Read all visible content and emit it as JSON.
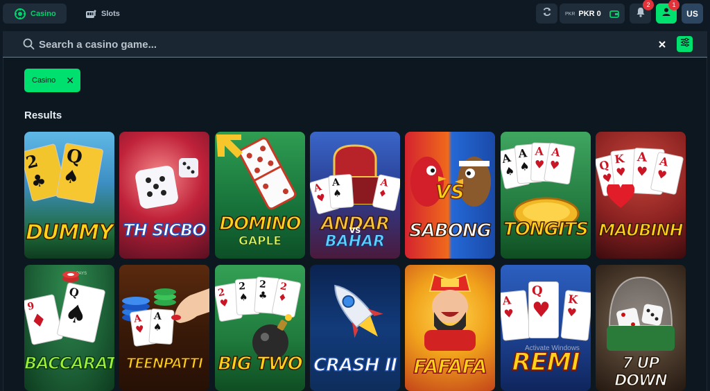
{
  "header": {
    "tabs": [
      {
        "label": "Casino",
        "icon": "casino-chip-icon",
        "active": true
      },
      {
        "label": "Slots",
        "icon": "slot-machine-icon",
        "active": false
      }
    ],
    "wallet": {
      "currency": "PKR",
      "balance": "PKR 0",
      "icon": "wallet-icon"
    },
    "notifications_count": "2",
    "profile_count": "1",
    "language": "US",
    "accent_color": "#00e06f"
  },
  "search": {
    "placeholder": "Search a casino game...",
    "value": ""
  },
  "filter_chip": {
    "label": "Casino"
  },
  "results": {
    "title": "Results",
    "games": [
      {
        "title": "DUMMY"
      },
      {
        "title": "TH SICBO"
      },
      {
        "title": "DOMINO",
        "subtitle": "GAPLE"
      },
      {
        "title": "ANDAR",
        "subtitle_connector": "VS",
        "subtitle": "BAHAR"
      },
      {
        "title": "SABONG",
        "badge": "VS"
      },
      {
        "title": "TONGITS"
      },
      {
        "title": "MAUBINH"
      },
      {
        "title": "BACCARAT",
        "table_text": "TIE PAYS"
      },
      {
        "title": "TEENPATTI"
      },
      {
        "title": "BIG TWO"
      },
      {
        "title": "CRASH II"
      },
      {
        "title": "FAFAFA"
      },
      {
        "title": "REMI"
      },
      {
        "title": "7 UP DOWN"
      }
    ]
  },
  "watermark": "Activate Windows"
}
